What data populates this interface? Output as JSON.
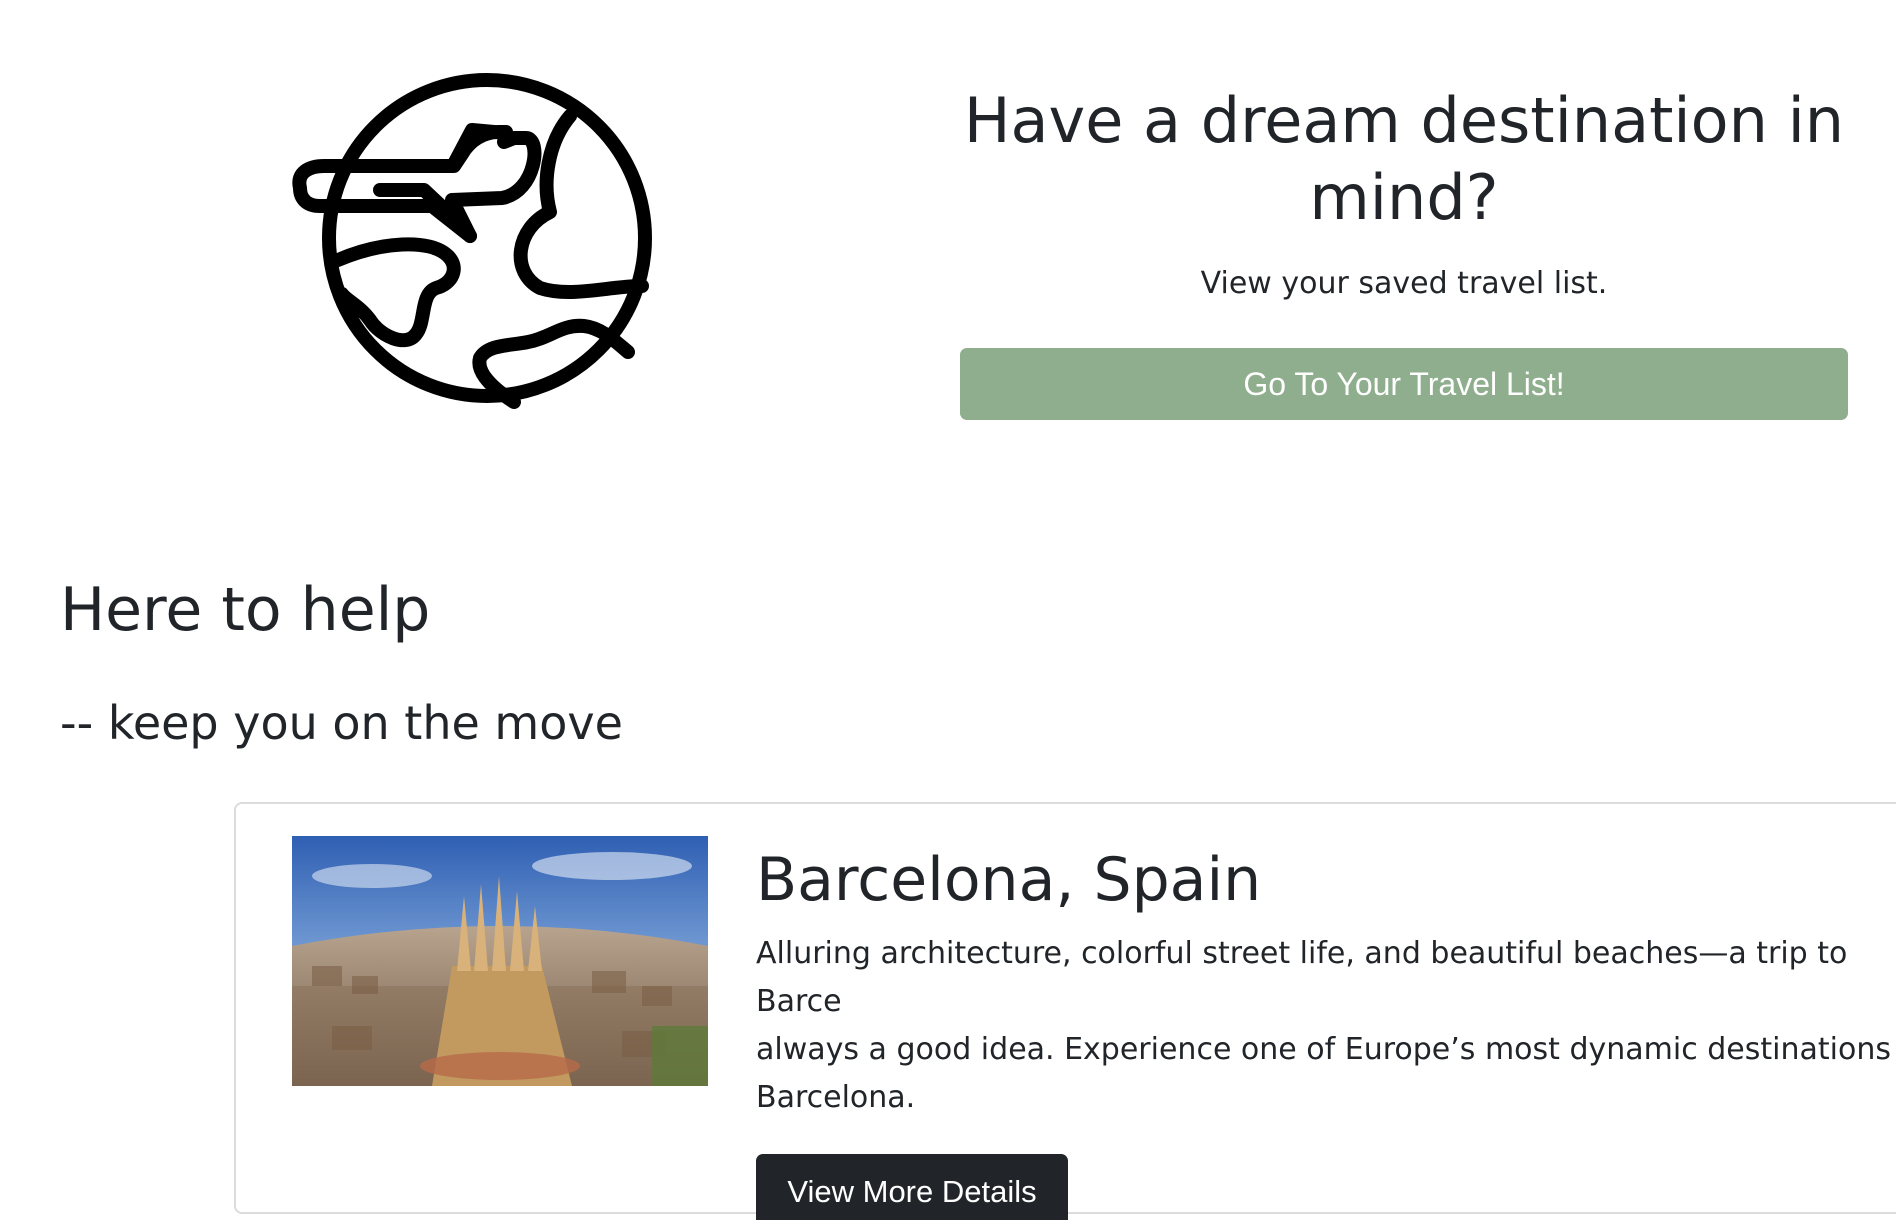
{
  "hero": {
    "logo_icon": "globe-airplane-icon",
    "title": "Have a dream destination in mind?",
    "subtitle": "View your saved travel list.",
    "button_label": "Go To Your Travel List!",
    "button_color": "#8fae8d"
  },
  "section": {
    "heading": "Here to help",
    "tagline": "-- keep you on the move"
  },
  "card": {
    "title": "Barcelona, Spain",
    "description": "Alluring architecture, colorful street life, and beautiful beaches—a trip to Barce\nalways a good idea. Experience one of Europe’s most dynamic destinations o\nBarcelona.",
    "button_label": "View More Details",
    "button_color": "#212529"
  }
}
